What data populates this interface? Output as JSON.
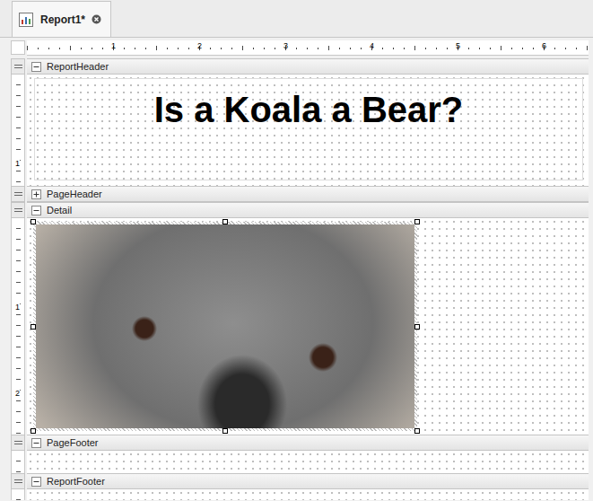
{
  "tab": {
    "title": "Report1*",
    "selected": true
  },
  "ruler": {
    "marks": [
      "1",
      "2",
      "3",
      "4",
      "5",
      "6"
    ]
  },
  "sections": [
    {
      "name": "ReportHeader",
      "expanded": true,
      "kind": "title",
      "rulerMarks": [
        "1"
      ],
      "title": "Is a Koala a Bear?"
    },
    {
      "name": "PageHeader",
      "expanded": false,
      "kind": "empty",
      "rulerMarks": []
    },
    {
      "name": "Detail",
      "expanded": true,
      "kind": "picture",
      "rulerMarks": [
        "1",
        "2"
      ],
      "picture": {
        "selected": true
      }
    },
    {
      "name": "PageFooter",
      "expanded": true,
      "kind": "empty",
      "rulerMarks": []
    },
    {
      "name": "ReportFooter",
      "expanded": true,
      "kind": "empty",
      "rulerMarks": []
    }
  ]
}
